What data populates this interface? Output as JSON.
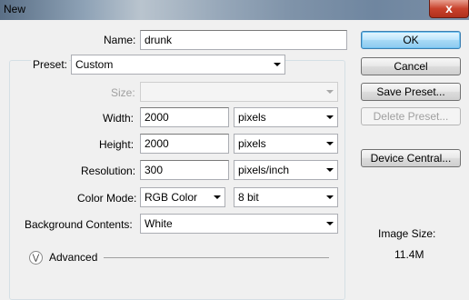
{
  "window": {
    "title": "New",
    "close_glyph": "x"
  },
  "form": {
    "name": {
      "label": "Name:",
      "value": "drunk"
    },
    "preset": {
      "label": "Preset:",
      "value": "Custom"
    },
    "size": {
      "label": "Size:",
      "value": ""
    },
    "width": {
      "label": "Width:",
      "value": "2000",
      "unit": "pixels"
    },
    "height": {
      "label": "Height:",
      "value": "2000",
      "unit": "pixels"
    },
    "resolution": {
      "label": "Resolution:",
      "value": "300",
      "unit": "pixels/inch"
    },
    "color_mode": {
      "label": "Color Mode:",
      "value": "RGB Color",
      "depth": "8 bit"
    },
    "background": {
      "label": "Background Contents:",
      "value": "White"
    },
    "advanced": {
      "label": "Advanced",
      "icon": "chevron-double-down-icon"
    }
  },
  "buttons": {
    "ok": "OK",
    "cancel": "Cancel",
    "save_preset": "Save Preset...",
    "delete_preset": "Delete Preset...",
    "device_central": "Device Central..."
  },
  "image_size": {
    "label": "Image Size:",
    "value": "11.4M"
  }
}
